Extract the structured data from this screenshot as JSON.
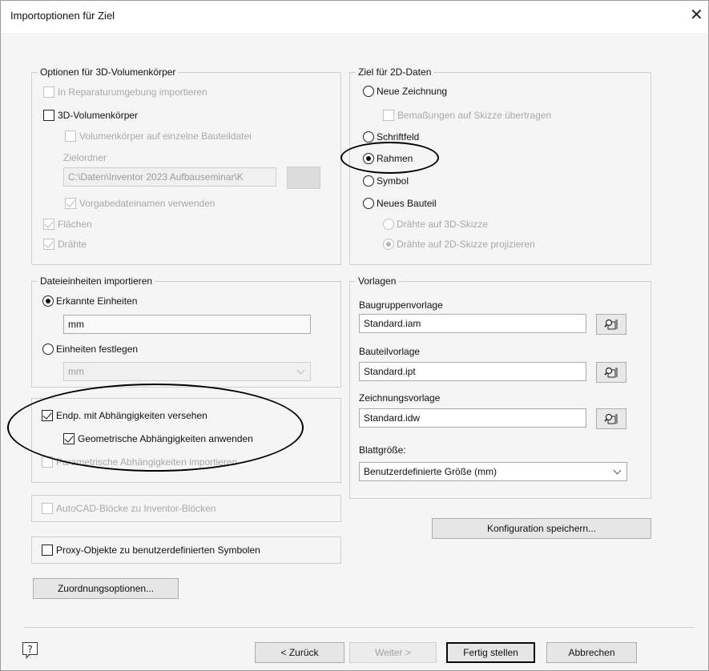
{
  "window": {
    "title": "Importoptionen für Ziel"
  },
  "solids_group": {
    "legend": "Optionen für 3D-Volumenkörper",
    "repair_env": "In Reparaturumgebung importieren",
    "solid_3d": "3D-Volumenkörper",
    "single_part": "Volumenkörper auf einzelne Bauteildatei",
    "target_folder_label": "Zielordner",
    "target_folder_value": "C:\\Daten\\Inventor 2023 Aufbauseminar\\K",
    "default_names": "Vorgabedateinamen verwenden",
    "surfaces": "Flächen",
    "wires": "Drähte"
  },
  "target_2d_group": {
    "legend": "Ziel für 2D-Daten",
    "new_drawing": "Neue Zeichnung",
    "transfer_dims": "Bemaßungen auf Skizze übertragen",
    "title_block": "Schriftfeld",
    "frame": "Rahmen",
    "symbol": "Symbol",
    "new_part": "Neues Bauteil",
    "wires_3d_sketch": "Drähte auf 3D-Skizze",
    "wires_2d_sketch": "Drähte auf 2D-Skizze projizieren",
    "selected": "Rahmen"
  },
  "units_group": {
    "legend": "Dateieinheiten importieren",
    "detected_units": "Erkannte Einheiten",
    "detected_value": "mm",
    "set_units": "Einheiten festlegen",
    "set_units_value": "mm"
  },
  "constraints_group": {
    "endpoints": "Endp. mit Abhängigkeiten versehen",
    "geometric": "Geometrische Abhängigkeiten anwenden",
    "parametric": "Parametrische Abhängigkeiten importieren"
  },
  "autocad_blocks": "AutoCAD-Blöcke zu Inventor-Blöcken",
  "proxy_objects": "Proxy-Objekte zu benutzerdefinierten Symbolen",
  "mapping_button": "Zuordnungsoptionen...",
  "templates_group": {
    "legend": "Vorlagen",
    "assembly_label": "Baugruppenvorlage",
    "assembly_value": "Standard.iam",
    "part_label": "Bauteilvorlage",
    "part_value": "Standard.ipt",
    "drawing_label": "Zeichnungsvorlage",
    "drawing_value": "Standard.idw",
    "sheet_size_label": "Blattgröße:",
    "sheet_size_value": "Benutzerdefinierte Größe (mm)"
  },
  "save_config_button": "Konfiguration speichern...",
  "footer": {
    "back": "< Zurück",
    "next": "Weiter >",
    "finish": "Fertig stellen",
    "cancel": "Abbrechen"
  }
}
